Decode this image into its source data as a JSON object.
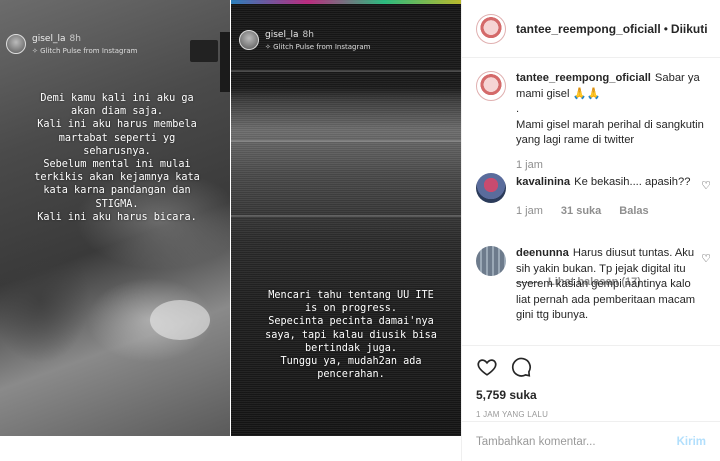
{
  "stories": [
    {
      "user": "gisel_la",
      "ago": "8h",
      "filter": "Glitch Pulse from Instagram",
      "text": "Demi kamu kali ini aku ga\nakan diam saja.\nKali ini aku harus membela\nmartabat seperti yg\nseharusnya.\nSebelum mental ini mulai\nterkikis akan kejamnya kata\nkata karna pandangan dan\nSTIGMA.\nKali ini aku harus bicara."
    },
    {
      "user": "gisel_la",
      "ago": "8h",
      "filter": "Glitch Pulse from Instagram",
      "text": "Mencari tahu tentang UU ITE\nis on progress.\nSepecinta pecinta damai'nya\nsaya, tapi kalau diusik bisa\nbertindak juga.\nTunggu ya, mudah2an ada\npencerahan."
    }
  ],
  "header": {
    "username": "tantee_reempong_oficiall",
    "separator": "•",
    "follow_label": "Diikuti"
  },
  "comments": [
    {
      "user": "tantee_reempong_oficiall",
      "text": "Sabar ya mami gisel 🙏🙏\n.\nMami gisel marah perihal di sangkutin yang lagi rame di twitter",
      "time": "1 jam"
    },
    {
      "user": "kavalinina",
      "text": "Ke bekasih.... apasih??",
      "time": "1 jam",
      "likes": "31 suka",
      "reply": "Balas",
      "view_replies": "Lihat balasan (17)"
    },
    {
      "user": "deenunna",
      "text": "Harus diusut tuntas. Aku sih yakin bukan. Tp jejak digital itu syerem kasian gempi nantinya kalo liat pernah ada pemberitaan macam gini ttg ibunya."
    }
  ],
  "actions": {
    "likes": "5,759 suka",
    "time": "1 JAM YANG LALU"
  },
  "add_comment": {
    "placeholder": "Tambahkan komentar...",
    "post_label": "Kirim"
  },
  "icons": {
    "like": "heart-icon",
    "comment": "comment-icon",
    "comment_like": "heart-icon"
  },
  "colors": {
    "post_button": "#b2dffc",
    "muted_text": "#8e8e8e"
  }
}
